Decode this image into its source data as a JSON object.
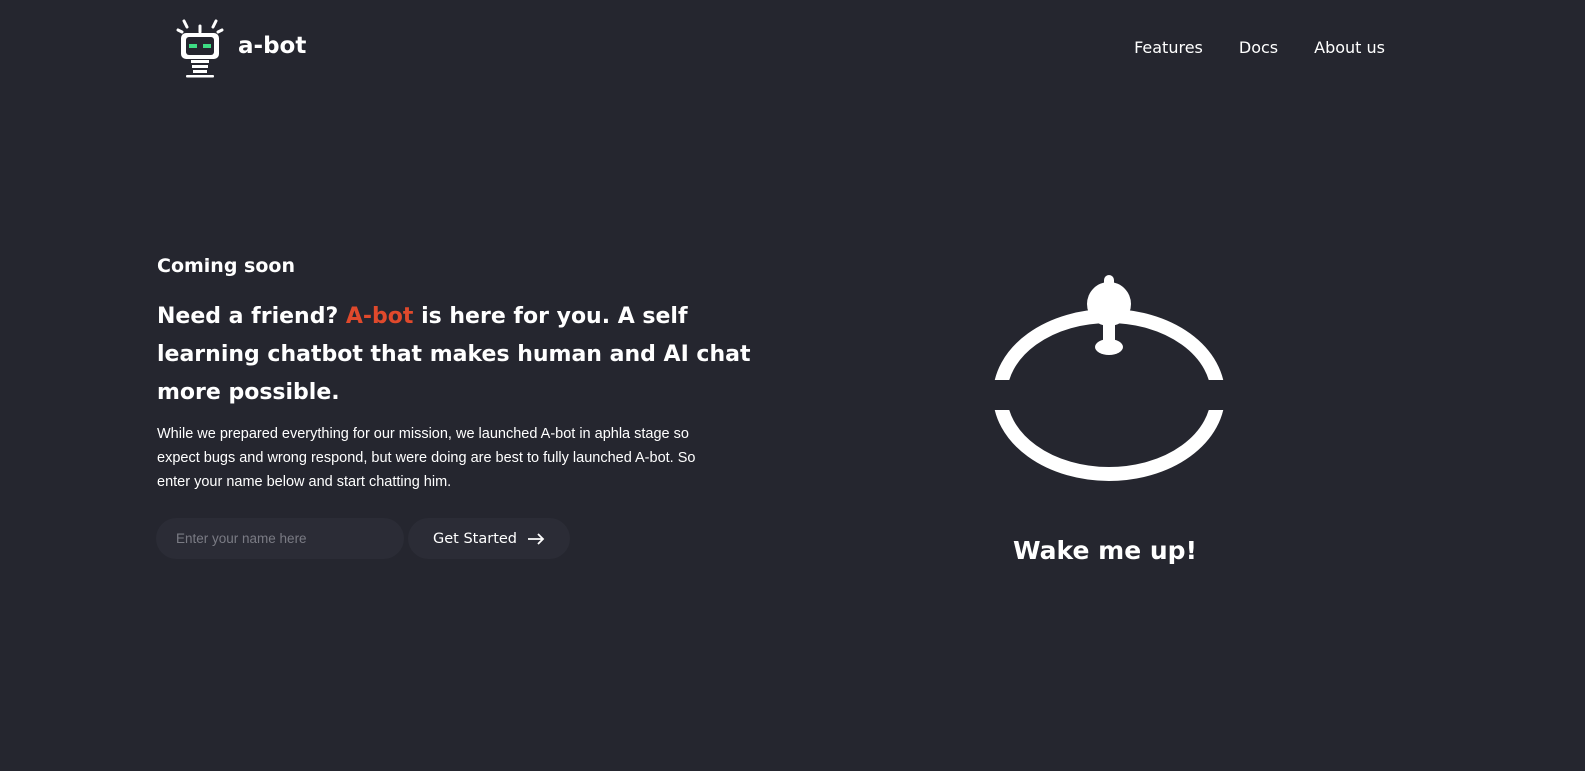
{
  "brand": {
    "name": "a-bot",
    "icon": "robot-icon",
    "eye_color": "#3ddc84"
  },
  "nav": {
    "items": [
      {
        "label": "Features"
      },
      {
        "label": "Docs"
      },
      {
        "label": "About us"
      }
    ]
  },
  "hero": {
    "eyebrow": "Coming soon",
    "headline_pre": "Need a friend? ",
    "headline_accent": "A-bot",
    "headline_post": " is here for you. A self learning chatbot that makes human and AI chat more possible.",
    "description": "While we prepared everything for our mission, we launched A-bot in aphla stage so expect bugs and wrong respond, but were doing are best to fully launched A-bot. So enter your name below and start chatting him.",
    "input_placeholder": "Enter your name here",
    "cta_label": "Get Started",
    "cta_icon": "arrow-right-icon",
    "accent_color": "#e0492c"
  },
  "bot": {
    "icon": "sleeping-bot-icon",
    "caption": "Wake me up!"
  }
}
